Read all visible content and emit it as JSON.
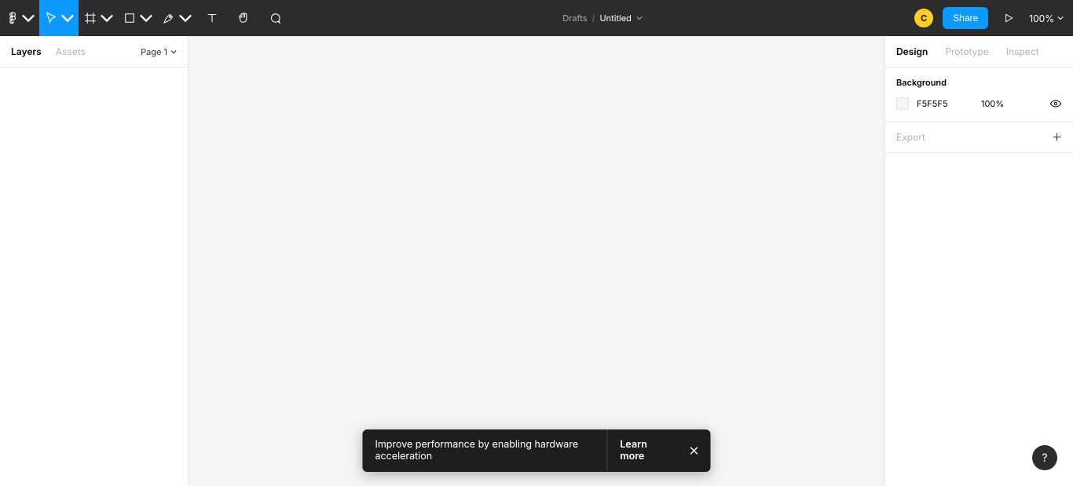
{
  "topbar": {
    "folder": "Drafts",
    "title": "Untitled",
    "avatar_initial": "C",
    "share_label": "Share",
    "zoom": "100%"
  },
  "leftPanel": {
    "tabs": [
      "Layers",
      "Assets"
    ],
    "active_tab_index": 0,
    "page_selector": "Page 1"
  },
  "rightPanel": {
    "tabs": [
      "Design",
      "Prototype",
      "Inspect"
    ],
    "active_tab_index": 0,
    "background": {
      "section_title": "Background",
      "hex": "F5F5F5",
      "opacity": "100%"
    },
    "export_label": "Export"
  },
  "toast": {
    "message": "Improve performance by enabling hardware acceleration",
    "action": "Learn more"
  },
  "help_label": "?"
}
